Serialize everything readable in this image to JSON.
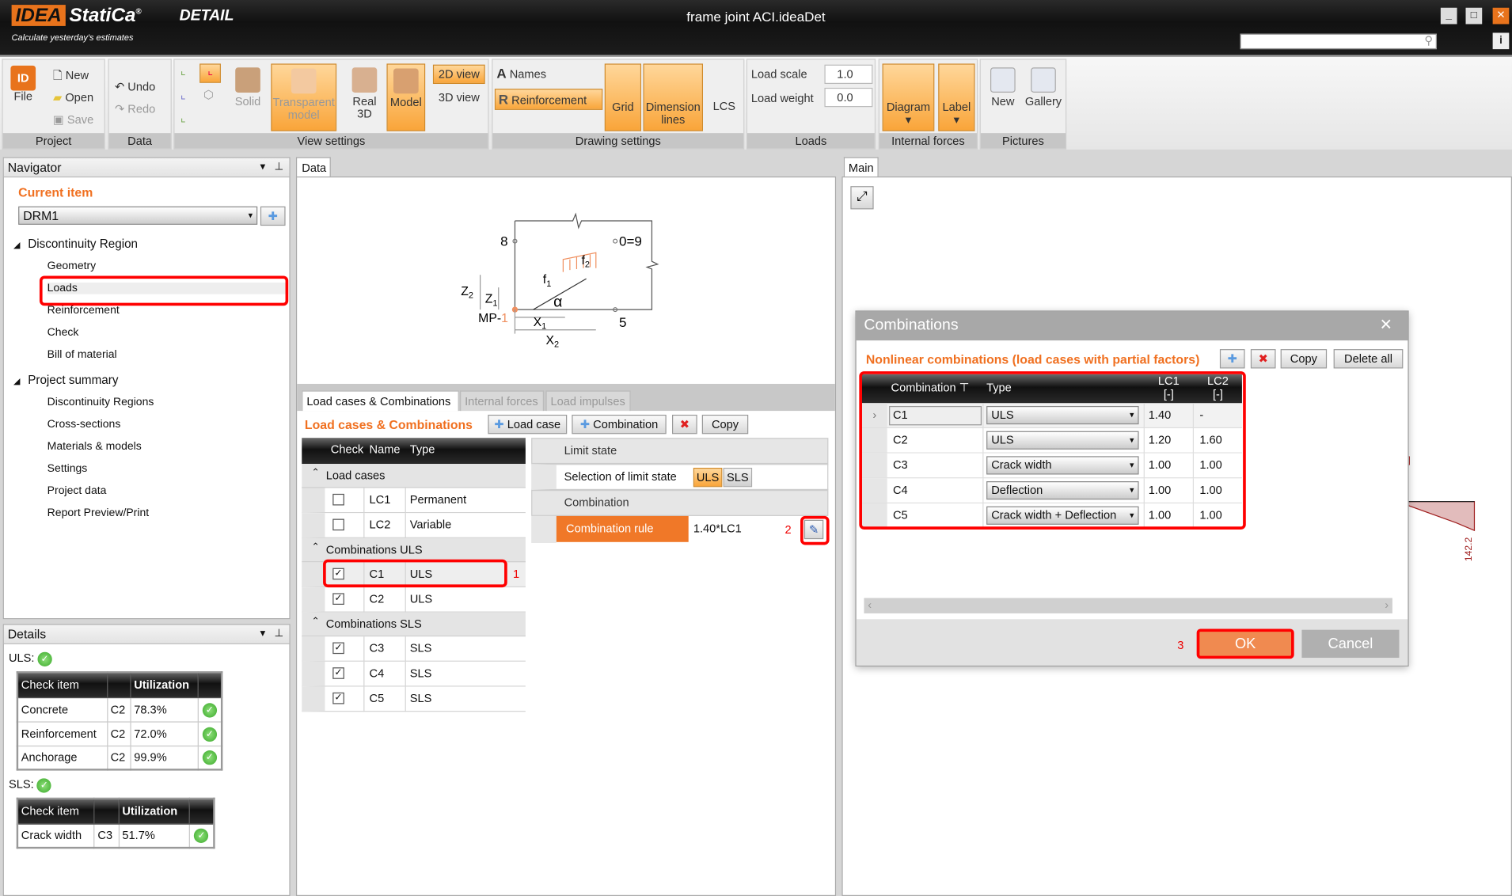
{
  "app": {
    "logo": "IDEA StatiCa",
    "product": "DETAIL",
    "slogan": "Calculate yesterday's estimates",
    "title": "frame joint ACI.ideaDet"
  },
  "ribbon": {
    "project": {
      "label": "Project",
      "file": "File",
      "new": "New",
      "open": "Open",
      "save": "Save"
    },
    "data": {
      "label": "Data",
      "undo": "Undo",
      "redo": "Redo"
    },
    "view": {
      "label": "View settings",
      "solid": "Solid",
      "transparent": "Transparent model",
      "real3d": "Real 3D",
      "model": "Model",
      "view2d": "2D view",
      "view3d": "3D view"
    },
    "drawing": {
      "label": "Drawing settings",
      "names": "Names",
      "reinforcement": "Reinforcement",
      "grid": "Grid",
      "dimension": "Dimension lines",
      "lcs": "LCS"
    },
    "loads": {
      "label": "Loads",
      "load_scale": "Load scale",
      "load_scale_value": "1.0",
      "load_weight": "Load weight",
      "load_weight_value": "0.0"
    },
    "internal": {
      "label": "Internal forces",
      "diagram": "Diagram",
      "labelbtn": "Label"
    },
    "pictures": {
      "label": "Pictures",
      "new": "New",
      "gallery": "Gallery"
    }
  },
  "navigator": {
    "title": "Navigator",
    "current_item": "Current item",
    "current_value": "DRM1",
    "groups": [
      {
        "label": "Discontinuity Region",
        "items": [
          "Geometry",
          "Loads",
          "Reinforcement",
          "Check",
          "Bill of material"
        ]
      },
      {
        "label": "Project summary",
        "items": [
          "Discontinuity Regions",
          "Cross-sections",
          "Materials & models",
          "Settings",
          "Project data",
          "Report Preview/Print"
        ]
      }
    ]
  },
  "details": {
    "title": "Details",
    "uls_label": "ULS:",
    "sls_label": "SLS:",
    "col_check": "Check item",
    "col_util": "Utilization",
    "uls_rows": [
      {
        "item": "Concrete",
        "comb": "C2",
        "util": "78.3%"
      },
      {
        "item": "Reinforcement",
        "comb": "C2",
        "util": "72.0%"
      },
      {
        "item": "Anchorage",
        "comb": "C2",
        "util": "99.9%"
      }
    ],
    "sls_rows": [
      {
        "item": "Crack width",
        "comb": "C3",
        "util": "51.7%"
      }
    ]
  },
  "data_panel": {
    "tab": "Data",
    "diagram": {
      "p8": "8",
      "p09": "0=9",
      "p5": "5",
      "f1": "f",
      "f2": "f",
      "alpha": "α",
      "mp": "MP-",
      "mp_num": "1",
      "x1": "X",
      "x2": "X",
      "z1": "Z",
      "z2": "Z",
      "s1": "1",
      "s2": "2"
    },
    "tabs": [
      "Load cases & Combinations",
      "Internal forces",
      "Load impulses"
    ],
    "section_title": "Load cases & Combinations",
    "btn_load_case": "Load case",
    "btn_combination": "Combination",
    "btn_copy": "Copy",
    "cols": [
      "Check",
      "Name",
      "Type"
    ],
    "groups": [
      {
        "label": "Load cases",
        "rows": [
          {
            "name": "LC1",
            "type": "Permanent",
            "checked": false
          },
          {
            "name": "LC2",
            "type": "Variable",
            "checked": false
          }
        ]
      },
      {
        "label": "Combinations ULS",
        "rows": [
          {
            "name": "C1",
            "type": "ULS",
            "checked": true
          },
          {
            "name": "C2",
            "type": "ULS",
            "checked": true
          }
        ]
      },
      {
        "label": "Combinations SLS",
        "rows": [
          {
            "name": "C3",
            "type": "SLS",
            "checked": true
          },
          {
            "name": "C4",
            "type": "SLS",
            "checked": true
          },
          {
            "name": "C5",
            "type": "SLS",
            "checked": true
          }
        ]
      }
    ],
    "props": {
      "limit_state": "Limit state",
      "selection": "Selection of limit state",
      "uls": "ULS",
      "sls": "SLS",
      "combination": "Combination",
      "rule_label": "Combination rule",
      "rule_value": "1.40*LC1"
    },
    "markers": [
      "1",
      "2",
      "3"
    ]
  },
  "main_panel": {
    "tab": "Main",
    "value_label": "142.2"
  },
  "dialog": {
    "title": "Combinations",
    "subtitle": "Nonlinear combinations (load cases with partial factors)",
    "copy": "Copy",
    "delete_all": "Delete all",
    "cols": {
      "combination": "Combination",
      "type": "Type",
      "lc1": "LC1",
      "lc2": "LC2",
      "unit": "[-]"
    },
    "rows": [
      {
        "name": "C1",
        "type": "ULS",
        "lc1": "1.40",
        "lc2": "-"
      },
      {
        "name": "C2",
        "type": "ULS",
        "lc1": "1.20",
        "lc2": "1.60"
      },
      {
        "name": "C3",
        "type": "Crack width",
        "lc1": "1.00",
        "lc2": "1.00"
      },
      {
        "name": "C4",
        "type": "Deflection",
        "lc1": "1.00",
        "lc2": "1.00"
      },
      {
        "name": "C5",
        "type": "Crack width + Deflection",
        "lc1": "1.00",
        "lc2": "1.00"
      }
    ],
    "ok": "OK",
    "cancel": "Cancel"
  },
  "colors": {
    "accent": "#f07020",
    "highlight": "#ff0000",
    "active_button": "#f9a53a"
  }
}
